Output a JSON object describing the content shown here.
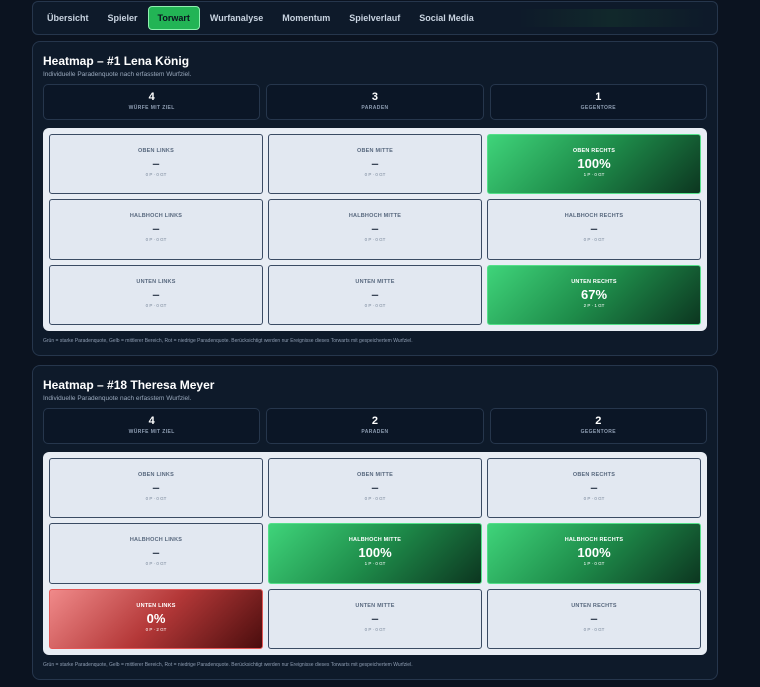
{
  "tabs": [
    {
      "label": "Übersicht"
    },
    {
      "label": "Spieler"
    },
    {
      "label": "Torwart"
    },
    {
      "label": "Wurfanalyse"
    },
    {
      "label": "Momentum"
    },
    {
      "label": "Spielverlauf"
    },
    {
      "label": "Social Media"
    }
  ],
  "active_tab": "Torwart",
  "colors": {
    "good": "#22b455",
    "bad": "#b43838",
    "neutral": "#e2e8f1"
  },
  "keepers": [
    {
      "title": "Heatmap – #1 Lena König",
      "subtitle": "Individuelle Paradenquote nach erfasstem Wurfziel.",
      "stats": [
        {
          "value": "4",
          "label": "WÜRFE MIT ZIEL"
        },
        {
          "value": "3",
          "label": "PARADEN"
        },
        {
          "value": "1",
          "label": "GEGENTORE"
        }
      ],
      "cells": [
        {
          "label": "OBEN LINKS",
          "value": "–",
          "meta": "0 P · 0 GT",
          "state": "neutral"
        },
        {
          "label": "OBEN MITTE",
          "value": "–",
          "meta": "0 P · 0 GT",
          "state": "neutral"
        },
        {
          "label": "OBEN RECHTS",
          "value": "100%",
          "meta": "1 P · 0 GT",
          "state": "good"
        },
        {
          "label": "HALBHOCH LINKS",
          "value": "–",
          "meta": "0 P · 0 GT",
          "state": "neutral"
        },
        {
          "label": "HALBHOCH MITTE",
          "value": "–",
          "meta": "0 P · 0 GT",
          "state": "neutral"
        },
        {
          "label": "HALBHOCH RECHTS",
          "value": "–",
          "meta": "0 P · 0 GT",
          "state": "neutral"
        },
        {
          "label": "UNTEN LINKS",
          "value": "–",
          "meta": "0 P · 0 GT",
          "state": "neutral"
        },
        {
          "label": "UNTEN MITTE",
          "value": "–",
          "meta": "0 P · 0 GT",
          "state": "neutral"
        },
        {
          "label": "UNTEN RECHTS",
          "value": "67%",
          "meta": "2 P · 1 GT",
          "state": "good"
        }
      ],
      "footnote": "Grün = starke Paradenquote, Gelb = mittlerer Bereich, Rot = niedrige Paradenquote. Berücksichtigt werden nur Ereignisse dieses Torwarts mit gespeichertem Wurfziel."
    },
    {
      "title": "Heatmap – #18 Theresa Meyer",
      "subtitle": "Individuelle Paradenquote nach erfasstem Wurfziel.",
      "stats": [
        {
          "value": "4",
          "label": "WÜRFE MIT ZIEL"
        },
        {
          "value": "2",
          "label": "PARADEN"
        },
        {
          "value": "2",
          "label": "GEGENTORE"
        }
      ],
      "cells": [
        {
          "label": "OBEN LINKS",
          "value": "–",
          "meta": "0 P · 0 GT",
          "state": "neutral"
        },
        {
          "label": "OBEN MITTE",
          "value": "–",
          "meta": "0 P · 0 GT",
          "state": "neutral"
        },
        {
          "label": "OBEN RECHTS",
          "value": "–",
          "meta": "0 P · 0 GT",
          "state": "neutral"
        },
        {
          "label": "HALBHOCH LINKS",
          "value": "–",
          "meta": "0 P · 0 GT",
          "state": "neutral"
        },
        {
          "label": "HALBHOCH MITTE",
          "value": "100%",
          "meta": "1 P · 0 GT",
          "state": "good"
        },
        {
          "label": "HALBHOCH RECHTS",
          "value": "100%",
          "meta": "1 P · 0 GT",
          "state": "good"
        },
        {
          "label": "UNTEN LINKS",
          "value": "0%",
          "meta": "0 P · 2 GT",
          "state": "bad"
        },
        {
          "label": "UNTEN MITTE",
          "value": "–",
          "meta": "0 P · 0 GT",
          "state": "neutral"
        },
        {
          "label": "UNTEN RECHTS",
          "value": "–",
          "meta": "0 P · 0 GT",
          "state": "neutral"
        }
      ],
      "footnote": "Grün = starke Paradenquote, Gelb = mittlerer Bereich, Rot = niedrige Paradenquote. Berücksichtigt werden nur Ereignisse dieses Torwarts mit gespeichertem Wurfziel."
    }
  ]
}
